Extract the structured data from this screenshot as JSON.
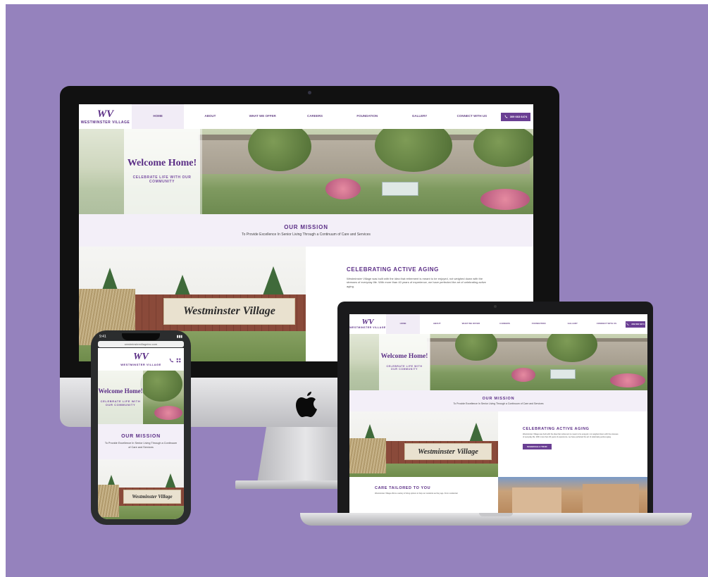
{
  "site": {
    "logo_mark": "WV",
    "logo_text": "WESTMINSTER VILLAGE",
    "nav": [
      "HOME",
      "ABOUT",
      "WHAT WE OFFER",
      "CAREERS",
      "FOUNDATION",
      "GALLERY",
      "CONNECT WITH US"
    ],
    "phone_label": "309 663 6474",
    "welcome_title": "Welcome Home!",
    "welcome_sub": "CELEBRATE LIFE WITH OUR COMMUNITY",
    "mission_title": "OUR MISSION",
    "mission_text": "To Provide Excellence In Senior Living Through a Continuum of Care and Services",
    "sign_text": "Westminster Village",
    "aging_title": "CELEBRATING ACTIVE AGING",
    "aging_text": "Westminster Village was built with the idea that retirement is meant to be enjoyed, not weighed down with the stresses of everyday life. With more than 40 years of experience, we have perfected the art of celebrating active aging.",
    "cta_label": "SCHEDULE A TOUR",
    "care_title": "CARE TAILORED TO YOU",
    "care_text": "Westminster Village offers a variety of living options to help our residents as they age. From residential"
  },
  "phone_device": {
    "time": "9:41",
    "url": "westminstervillageinc.com"
  },
  "colors": {
    "background": "#9582bd",
    "brand_purple": "#5b2e86",
    "button_purple": "#6a3f93"
  }
}
